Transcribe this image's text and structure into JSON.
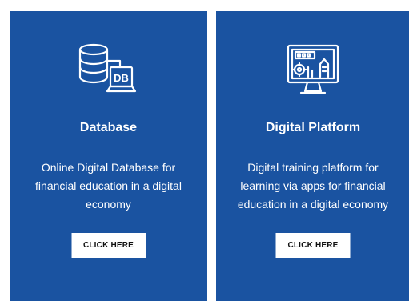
{
  "cards": [
    {
      "icon": "database-icon",
      "title": "Database",
      "description": "Online Digital Database for financial education in a digital economy",
      "button_label": "CLICK HERE",
      "icon_text": "DB"
    },
    {
      "icon": "digital-platform-icon",
      "title": "Digital Platform",
      "description": "Digital training platform for learning via apps for financial education in a digital economy",
      "button_label": "CLICK HERE"
    }
  ],
  "colors": {
    "card_background": "#1a53a1",
    "text": "#ffffff",
    "button_background": "#ffffff",
    "button_text": "#111111"
  }
}
